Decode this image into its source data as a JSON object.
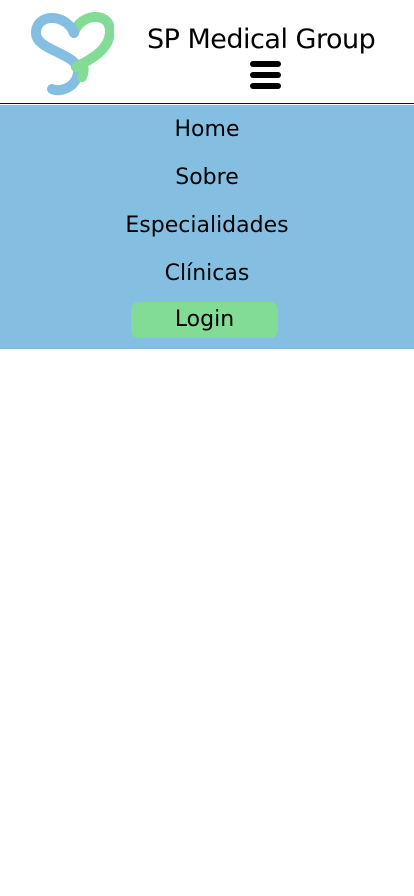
{
  "header": {
    "brand": "SP Medical Group",
    "logo_icon": "heart-s-logo-icon",
    "menu_icon": "hamburger-menu-icon"
  },
  "nav": {
    "items": [
      {
        "label": "Home"
      },
      {
        "label": "Sobre"
      },
      {
        "label": "Especialidades"
      },
      {
        "label": "Clínicas"
      }
    ],
    "login_label": "Login"
  },
  "colors": {
    "nav_background": "#84bfe2",
    "login_button": "#83dc95",
    "logo_blue": "#84bfe2",
    "logo_green": "#83dc95"
  }
}
